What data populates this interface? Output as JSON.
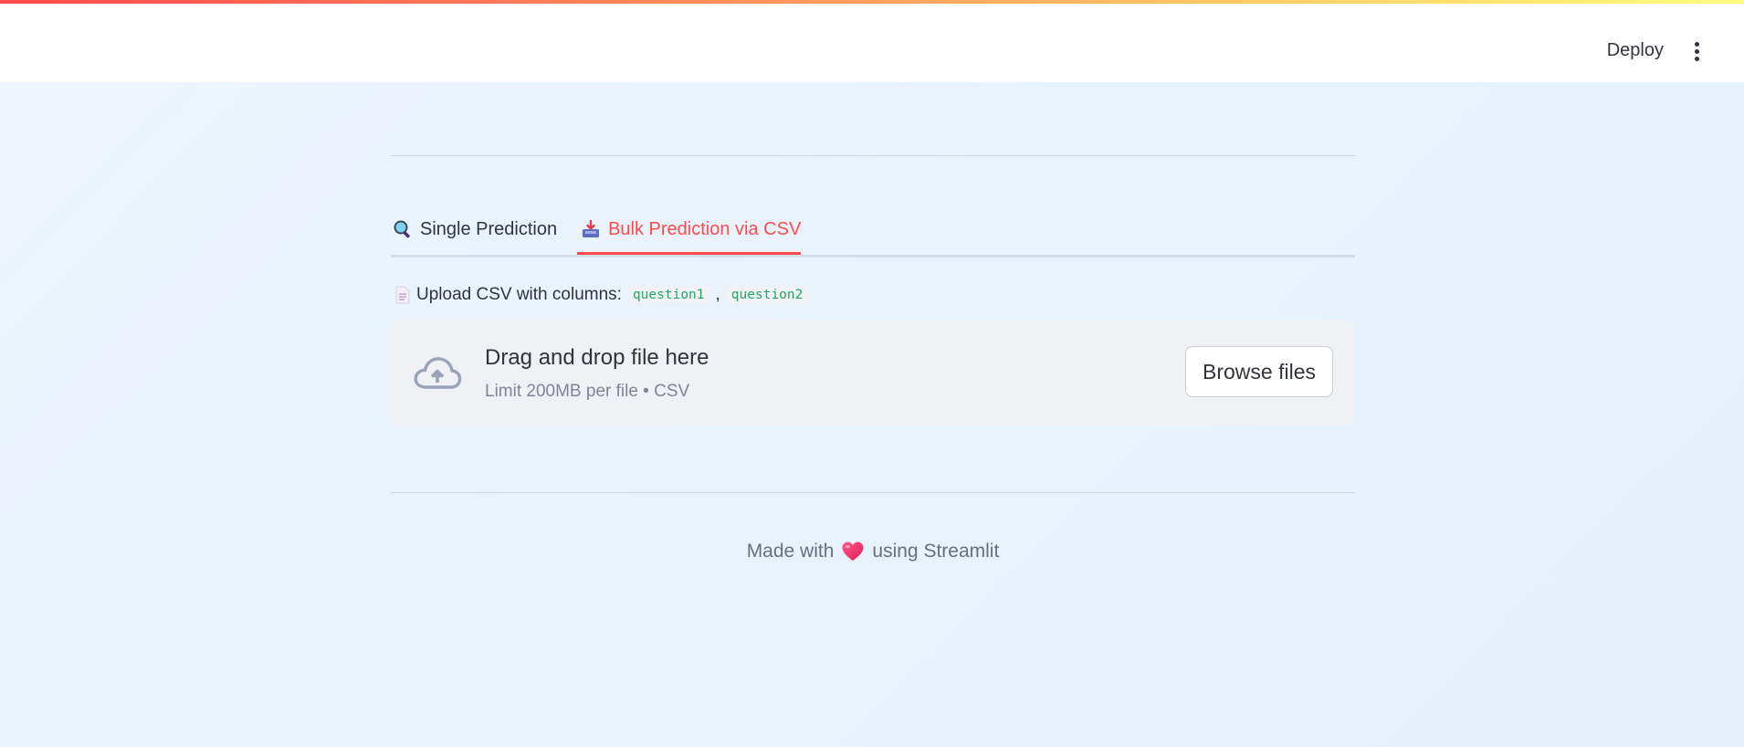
{
  "header": {
    "deploy_label": "Deploy",
    "menu_icon": "vertical-ellipsis-icon"
  },
  "tabs": [
    {
      "label": "Single Prediction",
      "icon": "magnifying-glass-icon",
      "active": false
    },
    {
      "label": "Bulk Prediction via CSV",
      "icon": "inbox-tray-icon",
      "active": true
    }
  ],
  "upload": {
    "label_text": "Upload CSV with columns:",
    "label_icon": "page-facing-up-icon",
    "columns": [
      "question1",
      "question2"
    ],
    "separator": ",",
    "dropzone_title": "Drag and drop file here",
    "dropzone_subtitle": "Limit 200MB per file • CSV",
    "browse_label": "Browse files"
  },
  "footer": {
    "text_before": "Made with",
    "text_after": "using Streamlit",
    "icon": "heart-icon"
  },
  "colors": {
    "accent": "#ff4b4b",
    "code_text": "#21a861",
    "background": "#e8f2fd"
  }
}
